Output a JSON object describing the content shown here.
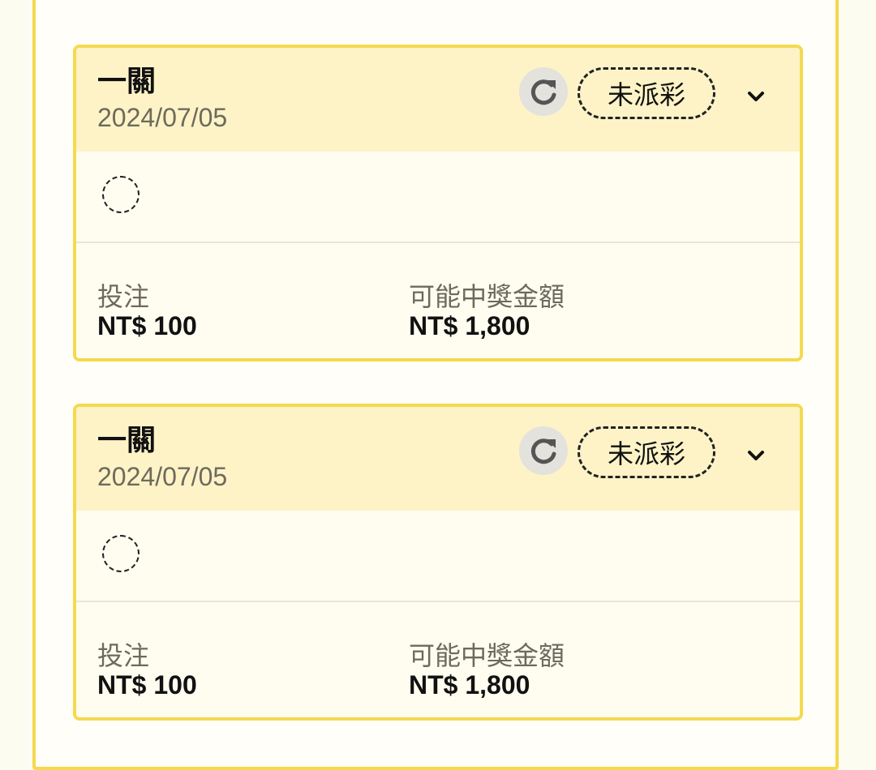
{
  "bets": [
    {
      "title": "一關",
      "date": "2024/07/05",
      "status": "未派彩",
      "stake_label": "投注",
      "stake_value": "NT$ 100",
      "payout_label": "可能中獎金額",
      "payout_value": "NT$ 1,800"
    },
    {
      "title": "一關",
      "date": "2024/07/05",
      "status": "未派彩",
      "stake_label": "投注",
      "stake_value": "NT$ 100",
      "payout_label": "可能中獎金額",
      "payout_value": "NT$ 1,800"
    }
  ],
  "icons": {
    "refresh": "refresh-icon",
    "expand": "chevron-down-icon"
  },
  "colors": {
    "accent": "#f5d94f",
    "header_bg": "#fdf3c7",
    "card_bg": "#fffdf0",
    "muted_text": "#6d6a5d"
  }
}
